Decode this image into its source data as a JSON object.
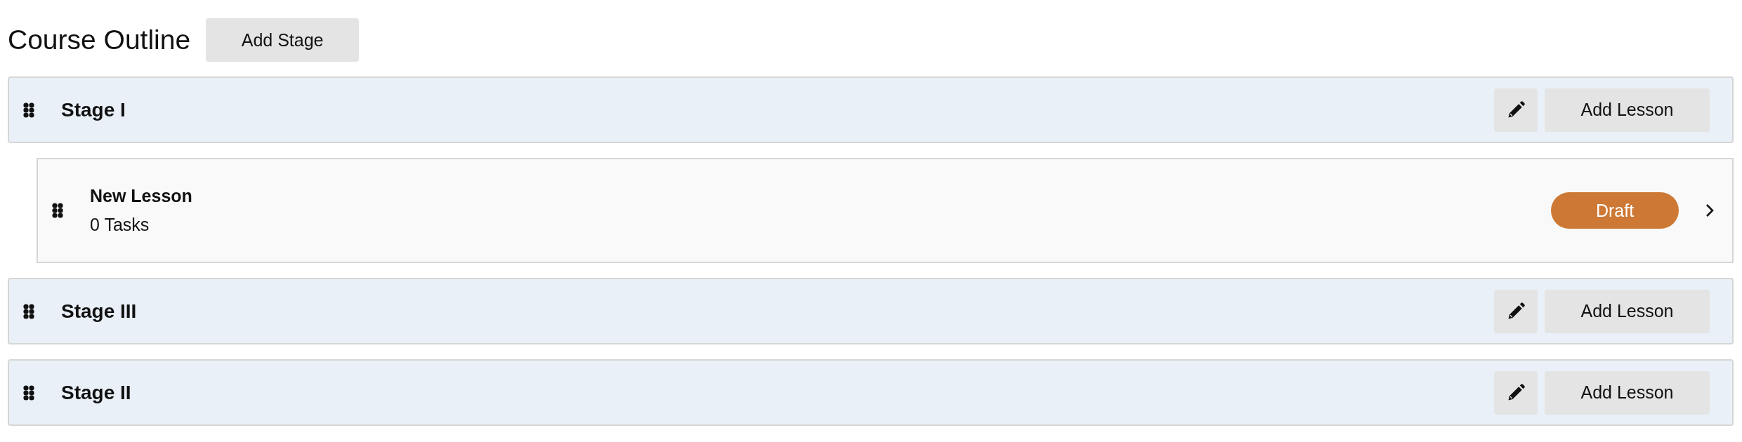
{
  "title": "Course Outline",
  "add_stage_button": "Add Stage",
  "stages": [
    {
      "title": "Stage I",
      "add_lesson_button": "Add Lesson",
      "lessons": [
        {
          "title": "New Lesson",
          "tasks": "0 Tasks",
          "status": {
            "label": "Draft",
            "kind": "draft"
          }
        }
      ]
    },
    {
      "title": "Stage III",
      "add_lesson_button": "Add Lesson"
    },
    {
      "title": "Stage II",
      "add_lesson_button": "Add Lesson"
    }
  ]
}
